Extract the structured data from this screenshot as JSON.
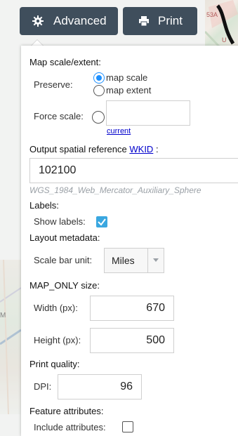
{
  "toolbar": {
    "advanced_label": "Advanced",
    "print_label": "Print",
    "advanced_icon": "gear-icon",
    "print_icon": "printer-icon",
    "button_color": "#3f4e5c"
  },
  "map_fragment_text": "53A",
  "map_fragment_text2": "U",
  "map_left_letter": "M",
  "panel": {
    "scale_extent": {
      "title": "Map scale/extent:",
      "preserve_label": "Preserve:",
      "option_scale": "map scale",
      "option_extent": "map extent",
      "selected": "map scale",
      "force_scale_label": "Force scale:",
      "force_scale_value": "",
      "current_link": "current"
    },
    "spatial_reference": {
      "title_prefix": "Output spatial reference",
      "wkid_link": "WKID",
      "title_suffix": ":",
      "value": "102100",
      "description": "WGS_1984_Web_Mercator_Auxiliary_Sphere"
    },
    "labels": {
      "title": "Labels:",
      "show_labels_label": "Show labels:",
      "show_labels_checked": true
    },
    "layout_metadata": {
      "title": "Layout metadata:",
      "scale_bar_unit_label": "Scale bar unit:",
      "scale_bar_unit_value": "Miles"
    },
    "map_only_size": {
      "title": "MAP_ONLY size:",
      "width_label": "Width (px):",
      "width_value": "670",
      "height_label": "Height (px):",
      "height_value": "500"
    },
    "print_quality": {
      "title": "Print quality:",
      "dpi_label": "DPI:",
      "dpi_value": "96"
    },
    "feature_attributes": {
      "title": "Feature attributes:",
      "include_label": "Include attributes:",
      "include_checked": false
    }
  },
  "colors": {
    "accent": "#3aa7e0",
    "radio_selected": "#1e90ff",
    "link": "#0000cc",
    "description_text": "#9aa0a6"
  }
}
